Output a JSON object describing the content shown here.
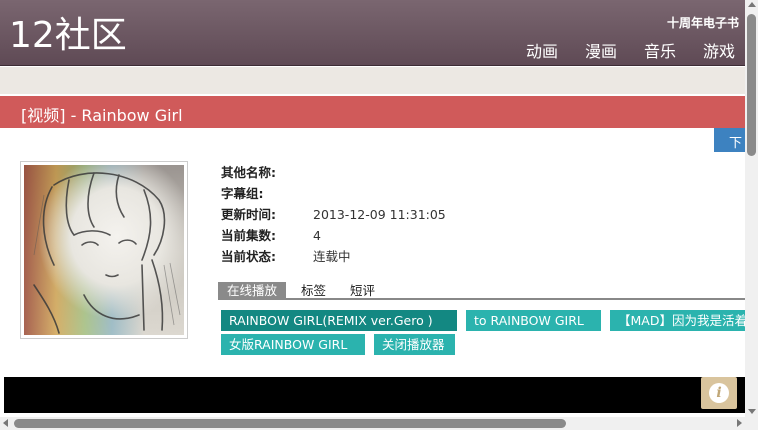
{
  "header": {
    "logo": "12社区",
    "top_link": "十周年电子书",
    "nav": [
      "动画",
      "漫画",
      "音乐",
      "游戏"
    ]
  },
  "title_bar": {
    "title": "[视频] - Rainbow Girl"
  },
  "download_tab": {
    "label": "下载"
  },
  "info": {
    "rows": [
      {
        "label": "其他名称:",
        "value": ""
      },
      {
        "label": "字幕组:",
        "value": ""
      },
      {
        "label": "更新时间:",
        "value": "2013-12-09 11:31:05"
      },
      {
        "label": "当前集数:",
        "value": "4"
      },
      {
        "label": "当前状态:",
        "value": "连载中"
      }
    ]
  },
  "tabs": [
    "在线播放",
    "标签",
    "短评"
  ],
  "episodes": [
    "RAINBOW GIRL(REMIX ver.Gero )",
    "to RAINBOW GIRL",
    "【MAD】因为我是活着的",
    "女版RAINBOW GIRL",
    "关闭播放器"
  ],
  "player": {
    "info_icon": "info-icon"
  },
  "colors": {
    "header": "#6b5560",
    "title_bar": "#d05a5a",
    "episode_active": "#138882",
    "episode": "#2bb3ae",
    "download": "#3d82c0"
  }
}
